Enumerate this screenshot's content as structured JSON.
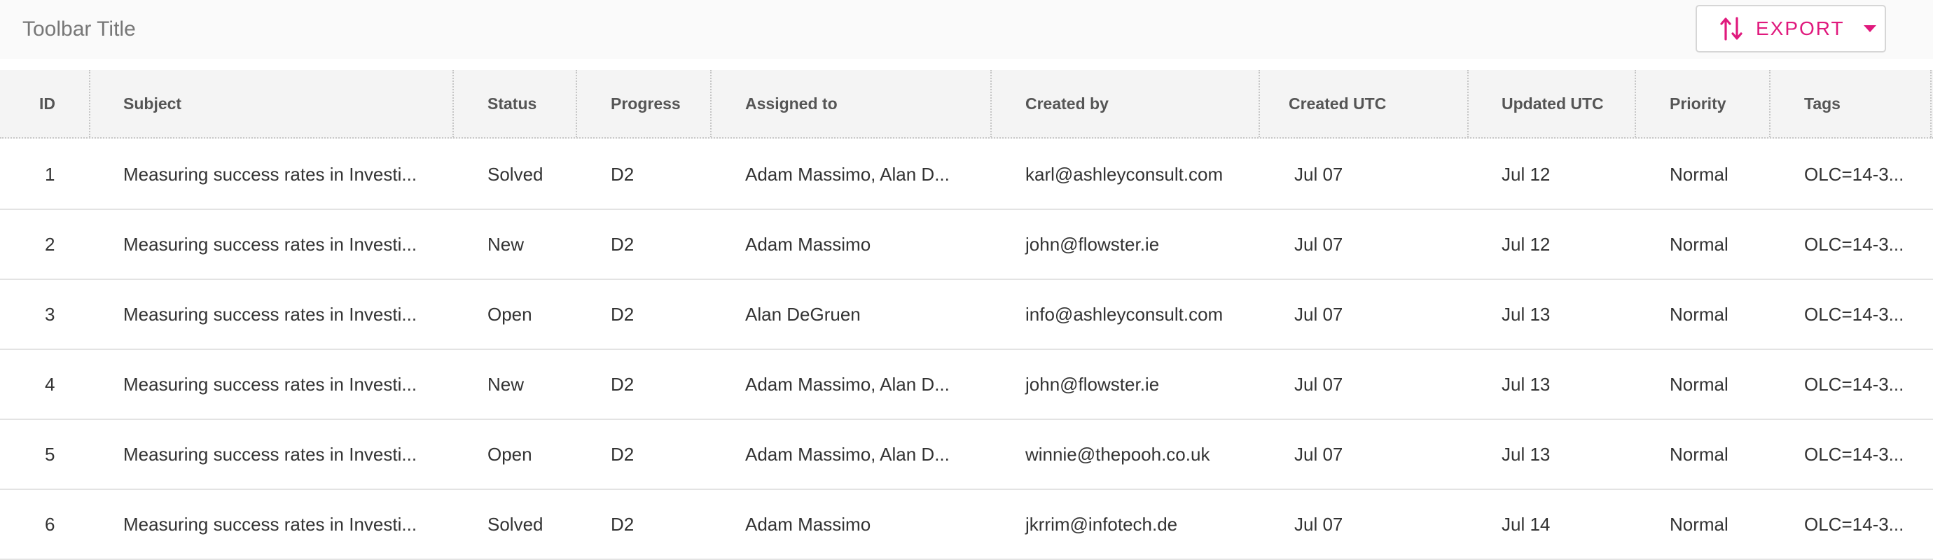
{
  "toolbar": {
    "title": "Toolbar Title",
    "export_label": "EXPORT"
  },
  "grid": {
    "columns": [
      "ID",
      "Subject",
      "Status",
      "Progress",
      "Assigned to",
      "Created by",
      "Created UTC",
      "Updated UTC",
      "Priority",
      "Tags"
    ],
    "rows": [
      [
        "1",
        "Measuring success rates in Investi...",
        "Solved",
        "D2",
        "Adam Massimo, Alan D...",
        "karl@ashleyconsult.com",
        "Jul 07",
        "Jul 12",
        "Normal",
        "OLC=14-3..."
      ],
      [
        "2",
        "Measuring success rates in Investi...",
        "New",
        "D2",
        "Adam Massimo",
        "john@flowster.ie",
        "Jul 07",
        "Jul 12",
        "Normal",
        "OLC=14-3..."
      ],
      [
        "3",
        "Measuring success rates in Investi...",
        "Open",
        "D2",
        "Alan DeGruen",
        "info@ashleyconsult.com",
        "Jul 07",
        "Jul 13",
        "Normal",
        "OLC=14-3..."
      ],
      [
        "4",
        "Measuring success rates in Investi...",
        "New",
        "D2",
        "Adam Massimo, Alan D...",
        "john@flowster.ie",
        "Jul 07",
        "Jul 13",
        "Normal",
        "OLC=14-3..."
      ],
      [
        "5",
        "Measuring success rates in Investi...",
        "Open",
        "D2",
        "Adam Massimo, Alan D...",
        "winnie@thepooh.co.uk",
        "Jul 07",
        "Jul 13",
        "Normal",
        "OLC=14-3..."
      ],
      [
        "6",
        "Measuring success rates in Investi...",
        "Solved",
        "D2",
        "Adam Massimo",
        "jkrrim@infotech.de",
        "Jul 07",
        "Jul 14",
        "Normal",
        "OLC=14-3..."
      ]
    ]
  },
  "icons": {
    "export": "sort-arrows-icon",
    "caret": "caret-down-icon"
  },
  "colors": {
    "accent": "#e0197d",
    "header_bg": "#f4f4f4",
    "toolbar_bg": "#fafafa"
  }
}
